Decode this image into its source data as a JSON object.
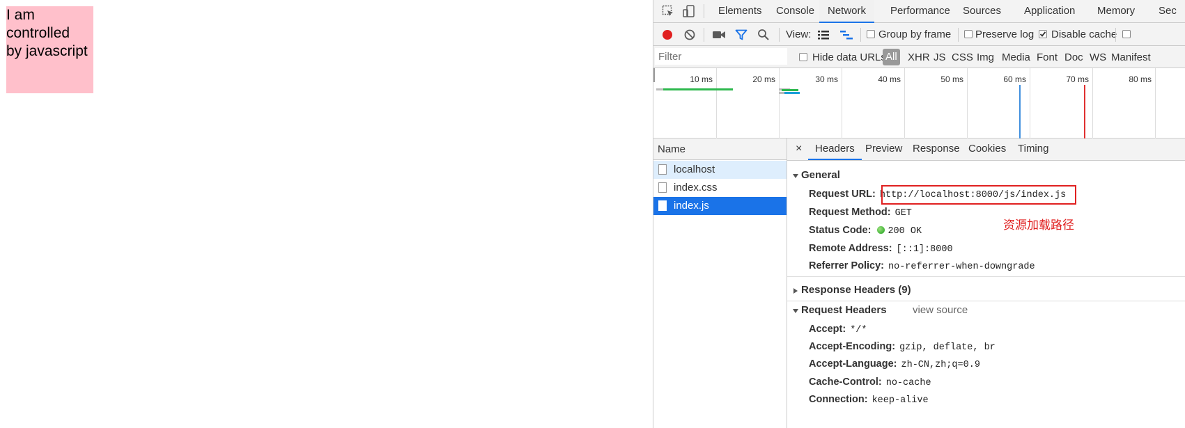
{
  "page": {
    "box_text": "I am\ncontrolled\nby javascript"
  },
  "devtools": {
    "main_tabs": [
      {
        "label": "Elements"
      },
      {
        "label": "Console"
      },
      {
        "label": "Network"
      },
      {
        "label": "Performance"
      },
      {
        "label": "Sources"
      },
      {
        "label": "Application"
      },
      {
        "label": "Memory"
      },
      {
        "label": "Sec"
      }
    ],
    "active_tab": "Network",
    "toolbar": {
      "view_label": "View:",
      "group_by_frame": "Group by frame",
      "preserve_log": "Preserve log",
      "disable_cache": "Disable cache",
      "disable_cache_checked": true
    },
    "filter": {
      "placeholder": "Filter",
      "hide_data_urls": "Hide data URLs",
      "types": [
        "All",
        "XHR",
        "JS",
        "CSS",
        "Img",
        "Media",
        "Font",
        "Doc",
        "WS",
        "Manifest"
      ]
    },
    "timeline": {
      "ticks": [
        "10 ms",
        "20 ms",
        "30 ms",
        "40 ms",
        "50 ms",
        "60 ms",
        "70 ms",
        "80 ms"
      ]
    },
    "name_pane": {
      "header": "Name",
      "requests": [
        {
          "name": "localhost",
          "state": "hover"
        },
        {
          "name": "index.css",
          "state": ""
        },
        {
          "name": "index.js",
          "state": "selected"
        }
      ]
    },
    "detail": {
      "close": "×",
      "tabs": [
        "Headers",
        "Preview",
        "Response",
        "Cookies",
        "Timing"
      ],
      "active_tab": "Headers",
      "general": {
        "title": "General",
        "request_url_key": "Request URL:",
        "request_url": "http://localhost:8000/js/index.js",
        "request_method_key": "Request Method:",
        "request_method": "GET",
        "status_code_key": "Status Code:",
        "status_code": "200 OK",
        "remote_address_key": "Remote Address:",
        "remote_address": "[::1]:8000",
        "referrer_policy_key": "Referrer Policy:",
        "referrer_policy": "no-referrer-when-downgrade",
        "annotation": "资源加载路径"
      },
      "response_headers": {
        "title": "Response Headers (9)"
      },
      "request_headers": {
        "title": "Request Headers",
        "view_source": "view source",
        "items": [
          {
            "key": "Accept:",
            "value": "*/*"
          },
          {
            "key": "Accept-Encoding:",
            "value": "gzip, deflate, br"
          },
          {
            "key": "Accept-Language:",
            "value": "zh-CN,zh;q=0.9"
          },
          {
            "key": "Cache-Control:",
            "value": "no-cache"
          },
          {
            "key": "Connection:",
            "value": "keep-alive"
          }
        ]
      }
    }
  }
}
